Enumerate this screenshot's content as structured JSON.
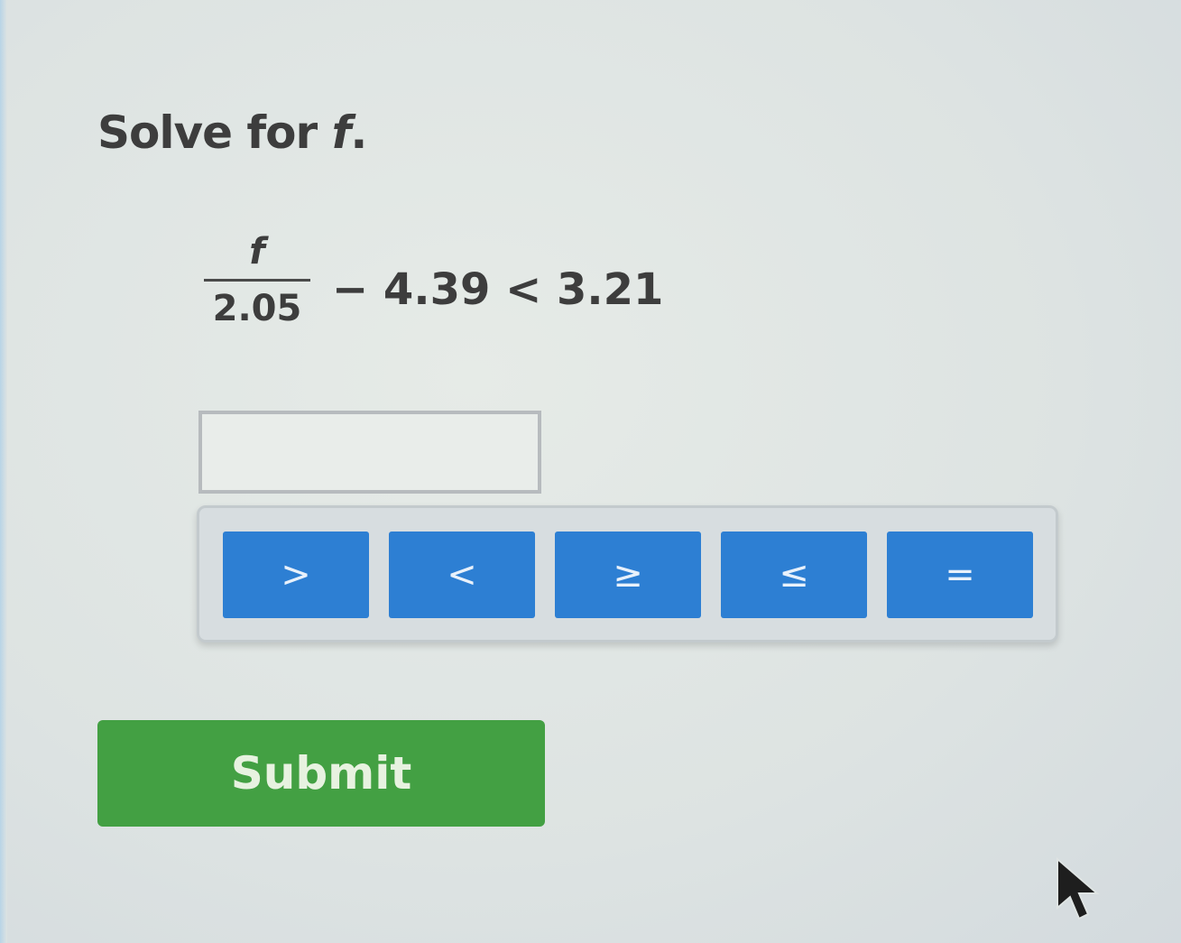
{
  "question": {
    "prompt_text": "Solve for ",
    "prompt_var": "f",
    "prompt_end": "."
  },
  "equation": {
    "numerator": "f",
    "denominator": "2.05",
    "rest": "− 4.39 < 3.21"
  },
  "answer_input": {
    "value": "",
    "placeholder": ""
  },
  "keypad": {
    "keys": [
      {
        "label": ">"
      },
      {
        "label": "<"
      },
      {
        "label": "≥"
      },
      {
        "label": "≤"
      },
      {
        "label": "="
      }
    ],
    "key_color": "#2d7fd3"
  },
  "submit": {
    "label": "Submit",
    "color": "#43a043"
  },
  "icons": {
    "cursor": "mouse-pointer-icon"
  }
}
